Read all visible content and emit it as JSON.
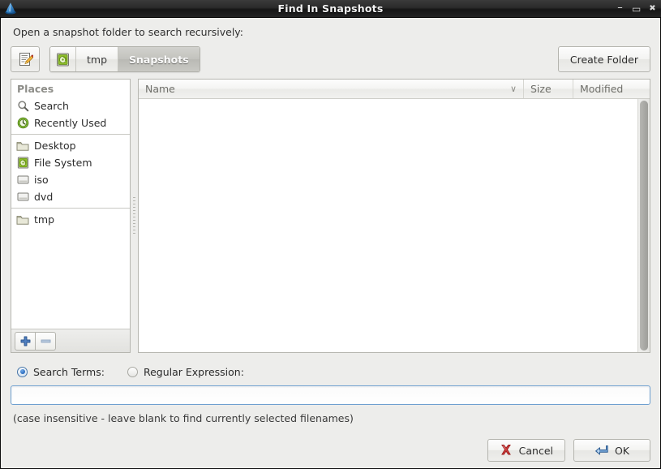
{
  "window": {
    "title": "Find In Snapshots",
    "icon": "app-cone-icon",
    "controls": {
      "minimize": "–",
      "maximize": "▭",
      "close": "✖"
    }
  },
  "prompt": "Open a snapshot folder to search recursively:",
  "toolbar": {
    "edit_name_icon": "document-pencil-icon",
    "create_folder_label": "Create Folder",
    "path_segments": [
      {
        "label": "",
        "icon": "hard-drive-icon",
        "active": false
      },
      {
        "label": "tmp",
        "icon": "",
        "active": false
      },
      {
        "label": "Snapshots",
        "icon": "",
        "active": true
      }
    ]
  },
  "places": {
    "header": "Places",
    "items": [
      {
        "label": "Search",
        "icon": "search-icon"
      },
      {
        "label": "Recently Used",
        "icon": "recent-clock-icon"
      },
      {
        "separator": true
      },
      {
        "label": "Desktop",
        "icon": "folder-icon"
      },
      {
        "label": "File System",
        "icon": "hard-drive-icon"
      },
      {
        "label": "iso",
        "icon": "drive-media-icon"
      },
      {
        "label": "dvd",
        "icon": "drive-media-icon"
      },
      {
        "separator": true
      },
      {
        "label": "tmp",
        "icon": "folder-icon"
      }
    ],
    "add_button": "add-place-button",
    "remove_button": "remove-place-button"
  },
  "files": {
    "columns": [
      {
        "label": "Name",
        "sort_indicator": "∨"
      },
      {
        "label": "Size"
      },
      {
        "label": "Modified"
      }
    ],
    "rows": []
  },
  "search": {
    "mode_options": [
      {
        "label": "Search Terms:",
        "selected": true
      },
      {
        "label": "Regular Expression:",
        "selected": false
      }
    ],
    "input_value": "",
    "input_placeholder": "",
    "hint": "(case insensitive - leave blank to find currently selected filenames)"
  },
  "actions": {
    "cancel_label": "Cancel",
    "ok_label": "OK",
    "cancel_icon": "red-x-icon",
    "ok_icon": "blue-enter-arrow-icon"
  },
  "colors": {
    "dialog_bg": "#ededeb",
    "titlebar_dark": "#232323",
    "accent_blue": "#2a6bbd",
    "cancel_red": "#c03030",
    "focus_border": "#6fa0d0"
  }
}
